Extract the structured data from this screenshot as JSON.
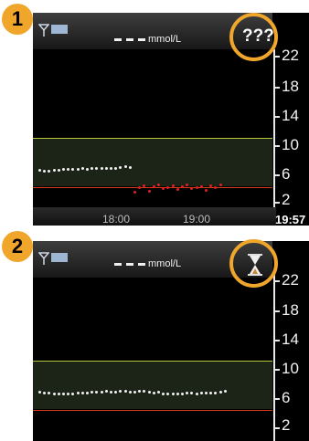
{
  "callouts": [
    "1",
    "2"
  ],
  "panel1": {
    "units": "mmol/L",
    "status_text": "???",
    "time_labels": [
      "18:00",
      "19:00"
    ],
    "current_time": "19:57"
  },
  "panel2": {
    "units": "mmol/L",
    "status_icon": "hourglass-icon"
  },
  "y_axis_labels": [
    "22",
    "18",
    "14",
    "10",
    "6",
    "2"
  ],
  "colors": {
    "callout": "#f0a52b",
    "high_limit": "#b9c83a",
    "low_limit": "#d93a1f",
    "normal_reading": "#f2f2f2",
    "flagged_reading": "#e12020"
  },
  "chart_data": [
    {
      "type": "scatter",
      "ylabel": "mmol/L",
      "ylim": [
        1,
        24
      ],
      "high_limit": 11,
      "low_limit": 4,
      "series": [
        {
          "x": [
            0,
            1,
            2,
            3,
            4,
            5,
            6,
            7,
            8,
            9,
            10,
            11,
            12,
            13,
            14,
            15,
            16,
            17,
            18,
            19,
            20,
            21,
            22,
            23,
            24,
            25,
            26
          ],
          "values": [
            6.6,
            6.5,
            6.5,
            6.6,
            6.6,
            6.7,
            6.7,
            6.8,
            6.8,
            6.9,
            6.8,
            6.9,
            6.9,
            6.9,
            6.9,
            6.9,
            6.9,
            7,
            7.1,
            7,
            null,
            null,
            null,
            null,
            null,
            null,
            null
          ]
        },
        {
          "x": [
            20,
            21,
            22,
            23,
            24,
            25,
            26,
            27,
            28,
            29,
            30,
            31,
            32,
            33,
            34,
            35,
            36,
            37,
            38
          ],
          "values": [
            3.6,
            4.2,
            4.5,
            3.8,
            4.4,
            4.6,
            4.1,
            4.3,
            4.5,
            4.0,
            4.4,
            4.6,
            4.1,
            4.3,
            4.4,
            3.9,
            4.5,
            4.3,
            4.6
          ]
        }
      ]
    },
    {
      "type": "scatter",
      "ylabel": "mmol/L",
      "ylim": [
        1,
        24
      ],
      "high_limit": 11,
      "low_limit": 4,
      "series": [
        {
          "x": [
            0,
            1,
            2,
            3,
            4,
            5,
            6,
            7,
            8,
            9,
            10,
            11,
            12,
            13,
            14,
            15,
            16,
            17,
            18,
            19,
            20,
            21,
            22,
            23,
            24,
            25,
            26,
            27,
            28,
            29,
            30,
            31,
            32,
            33,
            34,
            35,
            36,
            37,
            38,
            39
          ],
          "values": [
            7.1,
            7,
            7,
            6.9,
            6.9,
            6.9,
            6.9,
            6.9,
            7,
            7,
            7,
            7.1,
            7.1,
            7.1,
            7.2,
            7.1,
            7.1,
            7.2,
            7.2,
            7.1,
            7.1,
            7.2,
            7.2,
            7.1,
            7,
            7.1,
            6.9,
            6.9,
            6.9,
            6.9,
            6.9,
            7,
            7,
            6.9,
            7,
            7,
            7,
            7,
            7.1,
            7.2
          ]
        }
      ]
    }
  ]
}
